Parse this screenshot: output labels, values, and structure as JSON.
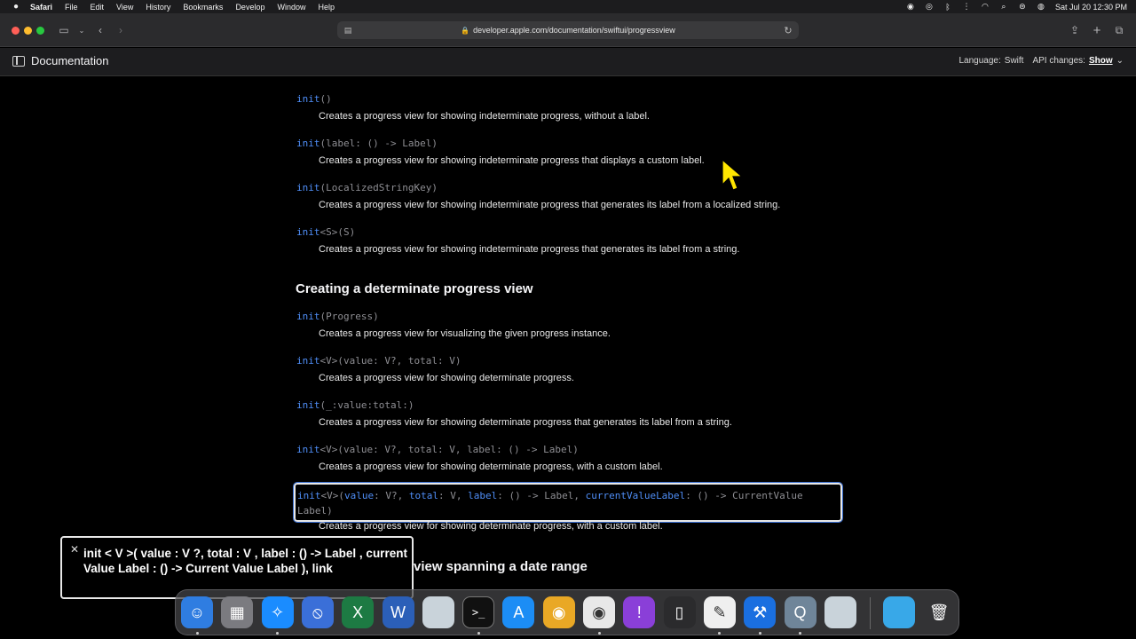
{
  "menubar": {
    "app": "Safari",
    "items": [
      "File",
      "Edit",
      "View",
      "History",
      "Bookmarks",
      "Develop",
      "Window",
      "Help"
    ],
    "clock": "Sat Jul 20  12:30 PM"
  },
  "toolbar": {
    "url": "developer.apple.com/documentation/swiftui/progressview"
  },
  "docheader": {
    "title": "Documentation",
    "language_label": "Language:",
    "language_value": "Swift",
    "api_label": "API changes:",
    "api_value": "Show"
  },
  "content": {
    "rows": [
      {
        "sig_kw": "init",
        "sig_rest": "()",
        "desc": "Creates a progress view for showing indeterminate progress, without a label."
      },
      {
        "sig_kw": "init",
        "sig_rest": "(label: () -> Label)",
        "desc": "Creates a progress view for showing indeterminate progress that displays a custom label."
      },
      {
        "sig_kw": "init",
        "sig_rest": "(LocalizedStringKey)",
        "desc": "Creates a progress view for showing indeterminate progress that generates its label from a localized string."
      },
      {
        "sig_kw": "init",
        "sig_rest": "<S>(S)",
        "desc": "Creates a progress view for showing indeterminate progress that generates its label from a string."
      }
    ],
    "section2_title": "Creating a determinate progress view",
    "rows2": [
      {
        "sig_kw": "init",
        "sig_rest": "(Progress)",
        "desc": "Creates a progress view for visualizing the given progress instance."
      },
      {
        "sig_kw": "init",
        "sig_rest": "<V>(value: V?, total: V)",
        "desc": "Creates a progress view for showing determinate progress."
      },
      {
        "sig_kw": "init",
        "sig_rest": "(_:value:total:)",
        "desc": "Creates a progress view for showing determinate progress that generates its label from a string."
      },
      {
        "sig_kw": "init",
        "sig_rest": "<V>(value: V?, total: V, label: () -> Label)",
        "desc": "Creates a progress view for showing determinate progress, with a custom label."
      }
    ],
    "focused_row": {
      "sig_line1_kw": "init",
      "sig_line1_a": "<V>(",
      "p_value": "value",
      "sig_line1_b": ": V?, ",
      "p_total": "total",
      "sig_line1_c": ": V, ",
      "p_label": "label",
      "sig_line1_d": ": () -> Label, ",
      "p_cvl": "currentValueLabel",
      "sig_line1_e": ": () -> CurrentValue",
      "sig_line2": "Label)",
      "desc": "Creates a progress view for showing determinate progress, with a custom label."
    },
    "peek_title": "view spanning a date range"
  },
  "voiceover": {
    "caption": "init < V >( value : V ?, total : V , label : () -> Label , current Value Label : () -> Current Value Label ), link"
  },
  "dock": {
    "apps": [
      {
        "name": "finder",
        "glyph": "☺",
        "color": "#2f7de1"
      },
      {
        "name": "launchpad",
        "glyph": "▦",
        "color": "#7b7b80"
      },
      {
        "name": "safari",
        "glyph": "✧",
        "color": "#1a8cff"
      },
      {
        "name": "blocked",
        "glyph": "⦸",
        "color": "#3a6fd8"
      },
      {
        "name": "excel",
        "glyph": "X",
        "color": "#1d7a43"
      },
      {
        "name": "word",
        "glyph": "W",
        "color": "#2b5fb8"
      },
      {
        "name": "preview",
        "glyph": "",
        "color": "#c9d3da"
      },
      {
        "name": "terminal",
        "glyph": ">_",
        "color": "#111111"
      },
      {
        "name": "app-store",
        "glyph": "A",
        "color": "#1c8df5"
      },
      {
        "name": "chrome-canary",
        "glyph": "◉",
        "color": "#e9a825"
      },
      {
        "name": "chrome",
        "glyph": "◉",
        "color": "#e8e8e8"
      },
      {
        "name": "feedback",
        "glyph": "!",
        "color": "#8a3fd8"
      },
      {
        "name": "iphone-mirroring",
        "glyph": "▯",
        "color": "#2b2b2d"
      },
      {
        "name": "textedit",
        "glyph": "✎",
        "color": "#efefef"
      },
      {
        "name": "xcode-beta",
        "glyph": "⚒",
        "color": "#1a6fe0"
      },
      {
        "name": "quicktime",
        "glyph": "Q",
        "color": "#6f8599"
      },
      {
        "name": "blank-app",
        "glyph": "",
        "color": "#c9d3da"
      }
    ],
    "trailing": [
      {
        "name": "downloads-folder",
        "glyph": "",
        "color": "#38a8e8"
      },
      {
        "name": "trash",
        "glyph": "🗑",
        "color": "transparent"
      }
    ]
  }
}
